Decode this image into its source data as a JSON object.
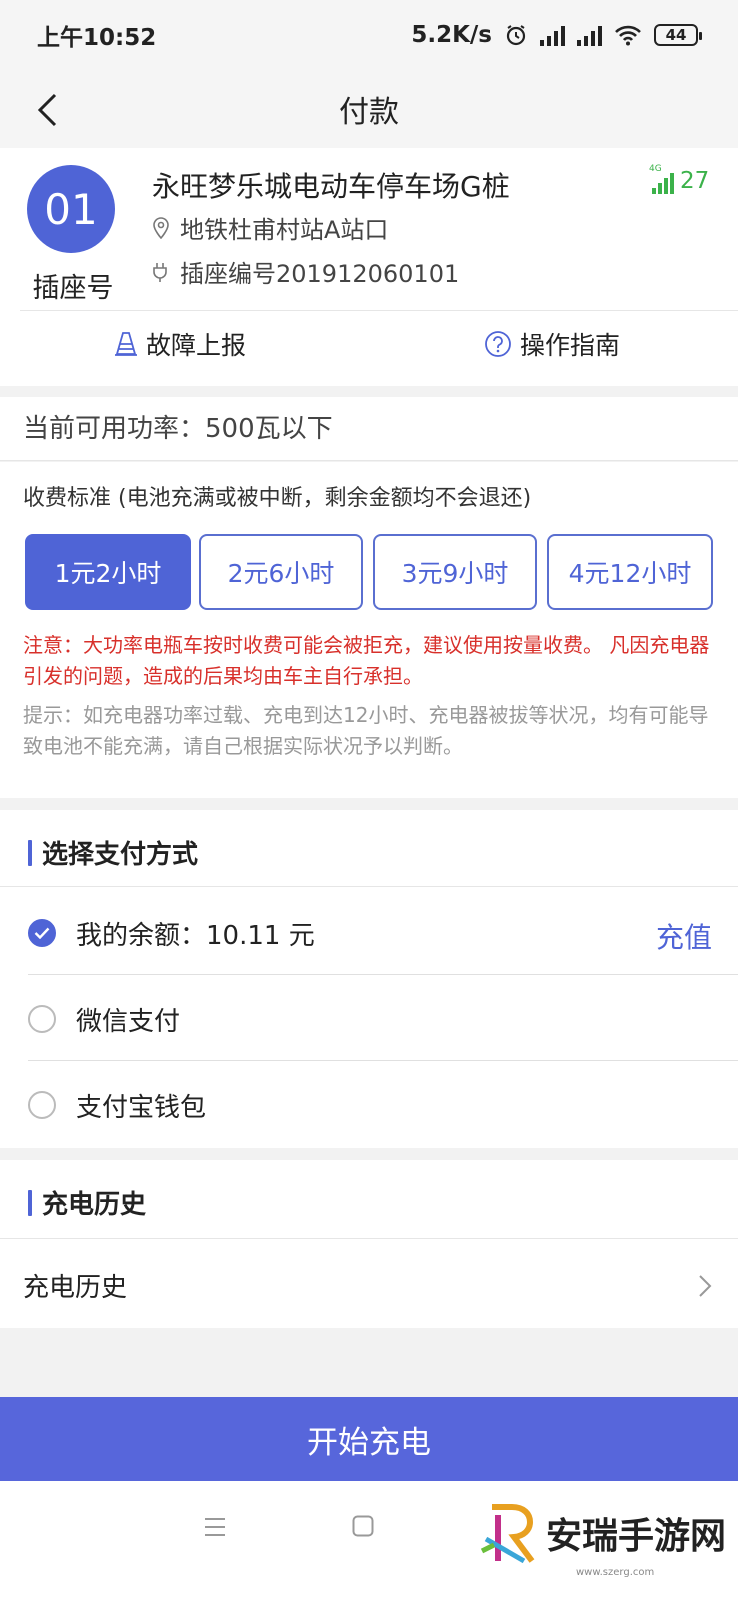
{
  "status_bar": {
    "time": "上午10:52",
    "net_speed": "5.2K/s",
    "battery": "44",
    "icons": [
      "alarm-icon",
      "hd-signal-icon",
      "hd-signal-icon",
      "wifi-icon",
      "battery-icon"
    ]
  },
  "header": {
    "title": "付款",
    "back_icon": "chevron-left-icon"
  },
  "station": {
    "plug_number": "01",
    "plug_label": "插座号",
    "name": "永旺梦乐城电动车停车场G桩",
    "signal_strength": "27",
    "location": "地铁杜甫村站A站口",
    "socket_code": "插座编号201912060101",
    "fault_report": "故障上报",
    "guide": "操作指南"
  },
  "power": {
    "text": "当前可用功率：500瓦以下"
  },
  "fees": {
    "label": "收费标准 (电池充满或被中断，剩余金额均不会退还)",
    "options": [
      "1元2小时",
      "2元6小时",
      "3元9小时",
      "4元12小时"
    ],
    "selected_index": 0,
    "warning": "注意：大功率电瓶车按时收费可能会被拒充，建议使用按量收费。 凡因充电器引发的问题，造成的后果均由车主自行承担。",
    "hint": "提示：如充电器功率过载、充电到达12小时、充电器被拔等状况，均有可能导致电池不能充满，请自己根据实际状况予以判断。"
  },
  "payment": {
    "section_title": "选择支付方式",
    "balance": "我的余额：10.11 元",
    "recharge": "充值",
    "wechat": "微信支付",
    "alipay": "支付宝钱包",
    "selected": "balance"
  },
  "history": {
    "section_title": "充电历史",
    "row_label": "充电历史"
  },
  "start_button": "开始充电",
  "watermark": {
    "text": "安瑞手游网",
    "sub": "www.szerg.com"
  },
  "colors": {
    "accent": "#4f64d6",
    "warning": "#d8302b",
    "signal": "#3bb24a"
  }
}
